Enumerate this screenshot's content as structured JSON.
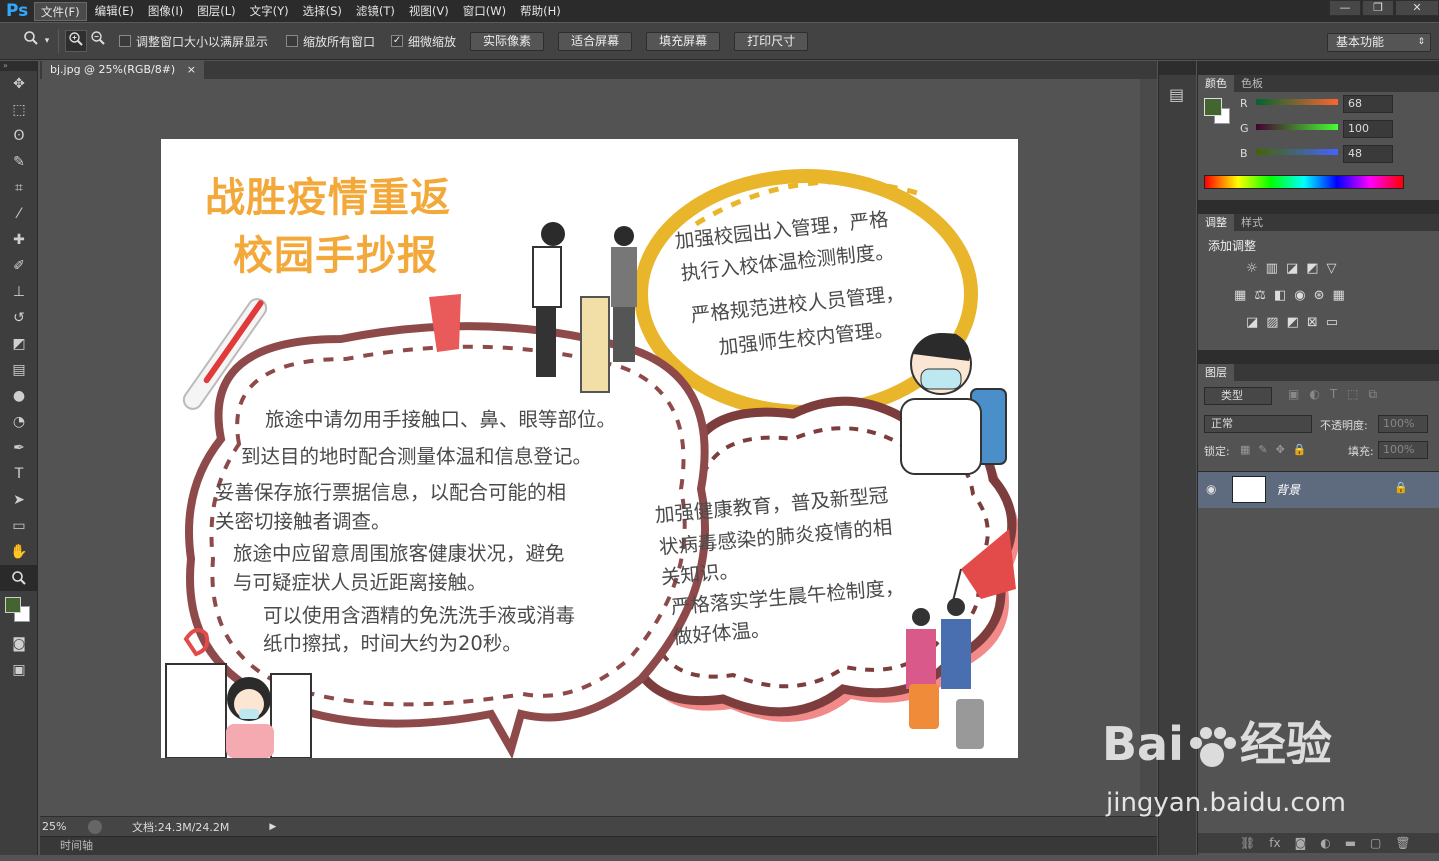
{
  "app": {
    "logo": "Ps"
  },
  "menu": [
    "文件(F)",
    "编辑(E)",
    "图像(I)",
    "图层(L)",
    "文字(Y)",
    "选择(S)",
    "滤镜(T)",
    "视图(V)",
    "窗口(W)",
    "帮助(H)"
  ],
  "window_controls": [
    "—",
    "❐",
    "✕"
  ],
  "options": {
    "check_resize": "调整窗口大小以满屏显示",
    "check_zoom_all": "缩放所有窗口",
    "check_scrubby": "细微缩放",
    "btn_actual": "实际像素",
    "btn_fit": "适合屏幕",
    "btn_fill": "填充屏幕",
    "btn_print": "打印尺寸",
    "workspace": "基本功能"
  },
  "doc_tab": {
    "label": "bj.jpg @ 25%(RGB/8#)",
    "close": "×"
  },
  "status": {
    "zoom": "25%",
    "doc_size": "文档:24.3M/24.2M"
  },
  "timeline_label": "时间轴",
  "color_panel": {
    "tabs": [
      "颜色",
      "色板"
    ],
    "r_label": "R",
    "g_label": "G",
    "b_label": "B",
    "r": "68",
    "g": "100",
    "b": "48",
    "fg_color": "#446430"
  },
  "adjust_panel": {
    "tabs": [
      "调整",
      "样式"
    ],
    "title": "添加调整"
  },
  "layers_panel": {
    "tab": "图层",
    "filter": "类型",
    "blend": "正常",
    "opacity_label": "不透明度:",
    "opacity": "100%",
    "lock_label": "锁定:",
    "fill_label": "填充:",
    "fill": "100%",
    "layer_name": "背景"
  },
  "poster": {
    "title1": "战胜疫情重返",
    "title2": "校园手抄报",
    "oval_l1": "加强校园出入管理，严格",
    "oval_l2": "执行入校体温检测制度。",
    "oval_l3": "严格规范进校人员管理，",
    "oval_l4": "加强师生校内管理。",
    "left_l1": "旅途中请勿用手接触口、鼻、眼等部位。",
    "left_l2": "到达目的地时配合测量体温和信息登记。",
    "left_l3": "妥善保存旅行票据信息，以配合可能的相",
    "left_l4": "关密切接触者调查。",
    "left_l5": "旅途中应留意周围旅客健康状况，避免",
    "left_l6": "与可疑症状人员近距离接触。",
    "left_l7": "可以使用含酒精的免洗洗手液或消毒",
    "left_l8": "纸巾擦拭，时间大约为20秒。",
    "cloud_l1": "加强健康教育，普及新型冠",
    "cloud_l2": "状病毒感染的肺炎疫情的相",
    "cloud_l3": "关知识。",
    "cloud_l4": "严格落实学生晨午检制度，",
    "cloud_l5": "做好体温。"
  },
  "watermark": {
    "brand": "Bai",
    "brand2": "经验",
    "url": "jingyan.baidu.com"
  }
}
